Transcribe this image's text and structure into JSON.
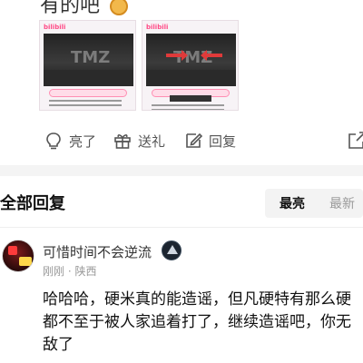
{
  "post": {
    "top_text_fragment": "有的吧",
    "top_emoji": "face-emoji"
  },
  "cards": [
    {
      "brand": "bilibili",
      "watermark": "TMZ"
    },
    {
      "brand": "bilibili",
      "watermark": "TMZ"
    }
  ],
  "actions": {
    "like_label": "亮了",
    "gift_label": "送礼",
    "reply_label": "回复"
  },
  "comments_section": {
    "title": "全部回复",
    "sort_options": [
      "最亮",
      "最新"
    ],
    "selected_sort": "最亮"
  },
  "comment": {
    "username": "可惜时间不会逆流",
    "time": "刚刚",
    "location": "陕西",
    "meta": "刚刚 · 陕西",
    "body": "哈哈哈，硬米真的能造谣，但凡硬特有那么硬都不至于被人家追着打了，继续造谣吧，你无敌了"
  },
  "colors": {
    "accent_pink": "#ff4b87",
    "text_primary": "#111111",
    "text_secondary": "#999999"
  }
}
